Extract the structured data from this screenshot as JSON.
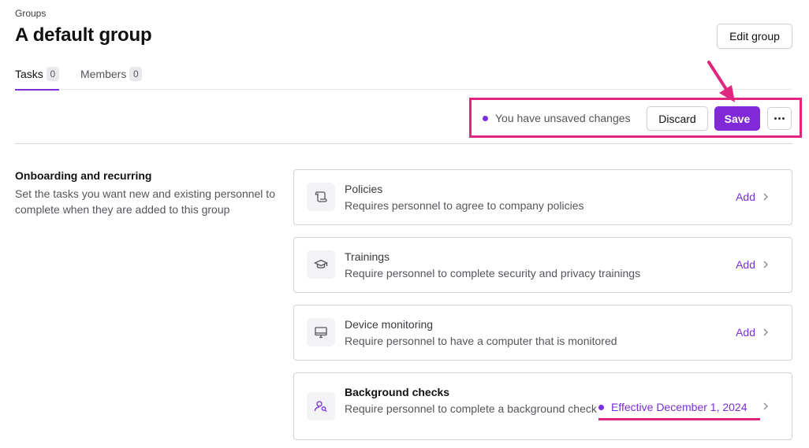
{
  "breadcrumb": "Groups",
  "page_title": "A default group",
  "edit_button": "Edit group",
  "tabs": [
    {
      "label": "Tasks",
      "count": "0"
    },
    {
      "label": "Members",
      "count": "0"
    }
  ],
  "toolbar": {
    "unsaved_text": "You have unsaved changes",
    "discard_label": "Discard",
    "save_label": "Save",
    "more_icon": "more-horizontal-icon"
  },
  "section": {
    "title": "Onboarding and recurring",
    "description": "Set the tasks you want new and existing personnel to complete when they are added to this group"
  },
  "cards": [
    {
      "title": "Policies",
      "description": "Requires personnel to agree to company policies",
      "action": "Add",
      "icon": "scroll-icon"
    },
    {
      "title": "Trainings",
      "description": "Require personnel to complete security and privacy trainings",
      "action": "Add",
      "icon": "graduation-cap-icon"
    },
    {
      "title": "Device monitoring",
      "description": "Require personnel to have a computer that is monitored",
      "action": "Add",
      "icon": "monitor-icon"
    },
    {
      "title": "Background checks",
      "description": "Require personnel to complete a background check",
      "status": "Effective December 1, 2024",
      "icon": "user-search-icon"
    }
  ],
  "colors": {
    "accent": "#8128d8",
    "annotation": "#e0267f"
  }
}
